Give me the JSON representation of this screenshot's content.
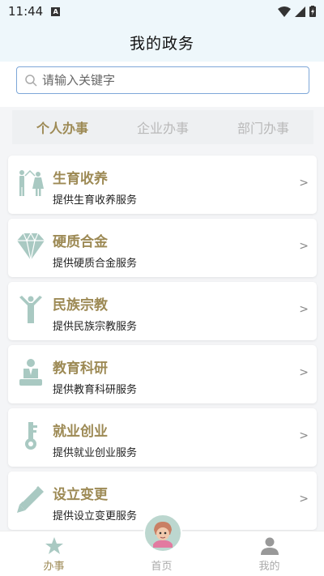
{
  "status": {
    "time": "11:44",
    "badge": "A"
  },
  "header": {
    "title": "我的政务"
  },
  "search": {
    "placeholder": "请输入关键字"
  },
  "tabs": [
    {
      "label": "个人办事",
      "active": true
    },
    {
      "label": "企业办事",
      "active": false
    },
    {
      "label": "部门办事",
      "active": false
    }
  ],
  "services": [
    {
      "title": "生育收养",
      "subtitle": "提供生育收养服务",
      "icon": "family-icon",
      "arrow": ">"
    },
    {
      "title": "硬质合金",
      "subtitle": "提供硬质合金服务",
      "icon": "diamond-icon",
      "arrow": ">"
    },
    {
      "title": "民族宗教",
      "subtitle": "提供民族宗教服务",
      "icon": "person-arms-up-icon",
      "arrow": ">"
    },
    {
      "title": "教育科研",
      "subtitle": "提供教育科研服务",
      "icon": "teacher-icon",
      "arrow": ">"
    },
    {
      "title": "就业创业",
      "subtitle": "提供就业创业服务",
      "icon": "key-icon",
      "arrow": ">"
    },
    {
      "title": "设立变更",
      "subtitle": "提供设立变更服务",
      "icon": "pencil-icon",
      "arrow": ">"
    }
  ],
  "tabbar": [
    {
      "label": "办事",
      "icon": "star-icon",
      "active": true
    },
    {
      "label": "首页",
      "icon": "avatar-icon",
      "active": false
    },
    {
      "label": "我的",
      "icon": "user-icon",
      "active": false
    }
  ],
  "colors": {
    "accent": "#9d8a55",
    "icon": "#a9c9c2",
    "header_bg": "#eef7fb"
  }
}
